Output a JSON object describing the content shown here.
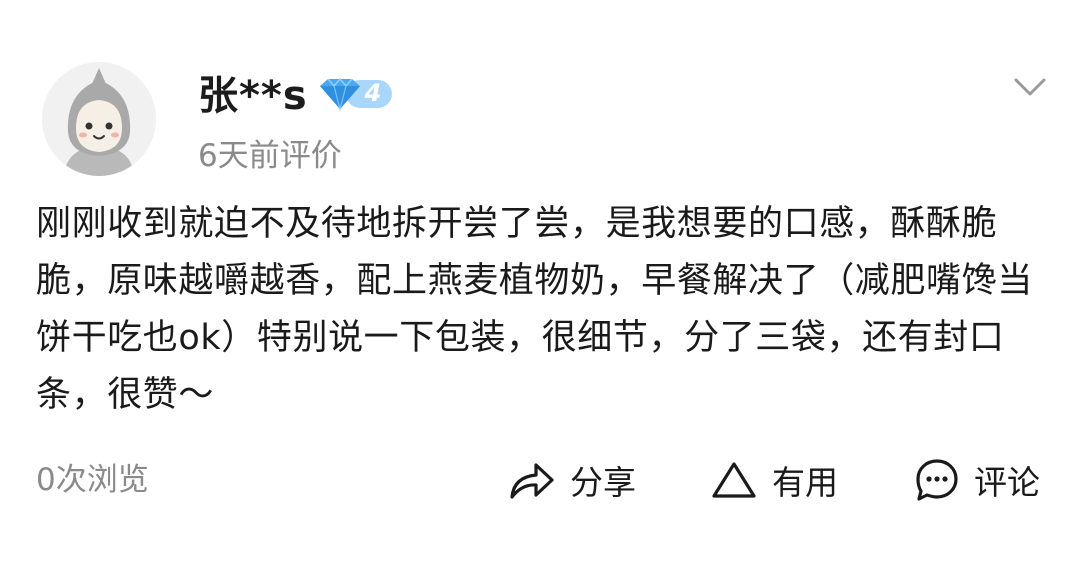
{
  "user": {
    "name": "张**s",
    "level": "4",
    "review_time": "6天前评价"
  },
  "review": {
    "text": "刚刚收到就迫不及待地拆开尝了尝，是我想要的口感，酥酥脆脆，原味越嚼越香，配上燕麦植物奶，早餐解决了（减肥嘴馋当饼干吃也ok）特别说一下包装，很细节，分了三袋，还有封口条，很赞～"
  },
  "footer": {
    "views": "0次浏览",
    "share_label": "分享",
    "useful_label": "有用",
    "comment_label": "评论"
  },
  "icons": {
    "avatar": "cartoon-avatar-icon",
    "badge": "diamond-level-badge-icon",
    "expand": "chevron-down-icon",
    "share": "share-arrow-icon",
    "useful": "triangle-icon",
    "comment": "comment-bubble-icon"
  },
  "colors": {
    "badge_blue": "#4aa8f0",
    "secondary_text": "#8a8a8a"
  }
}
